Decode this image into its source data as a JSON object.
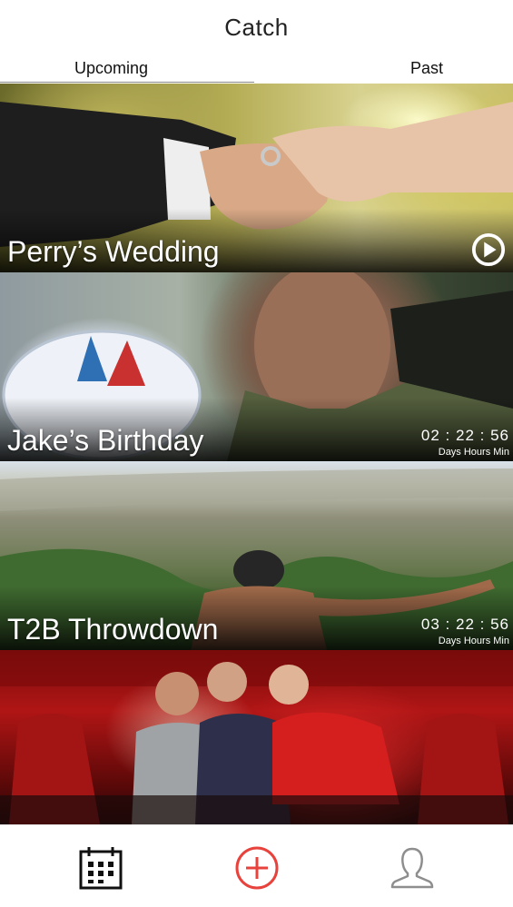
{
  "app": {
    "title": "Catch"
  },
  "tabs": [
    {
      "label": "Upcoming",
      "active": true
    },
    {
      "label": "Past",
      "active": false
    }
  ],
  "events": [
    {
      "name": "Perry’s Wedding",
      "action_icon": "play-icon"
    },
    {
      "name": "Jake’s Birthday",
      "countdown": "02 : 22 : 56",
      "units": "Days Hours Min"
    },
    {
      "name": "T2B Throwdown",
      "countdown": "03 : 22 : 56",
      "units": "Days Hours Min"
    },
    {
      "name": ""
    }
  ],
  "bottom_nav": [
    {
      "icon": "calendar-icon"
    },
    {
      "icon": "add-event-icon",
      "color": "#e8423c"
    },
    {
      "icon": "profile-icon"
    }
  ]
}
